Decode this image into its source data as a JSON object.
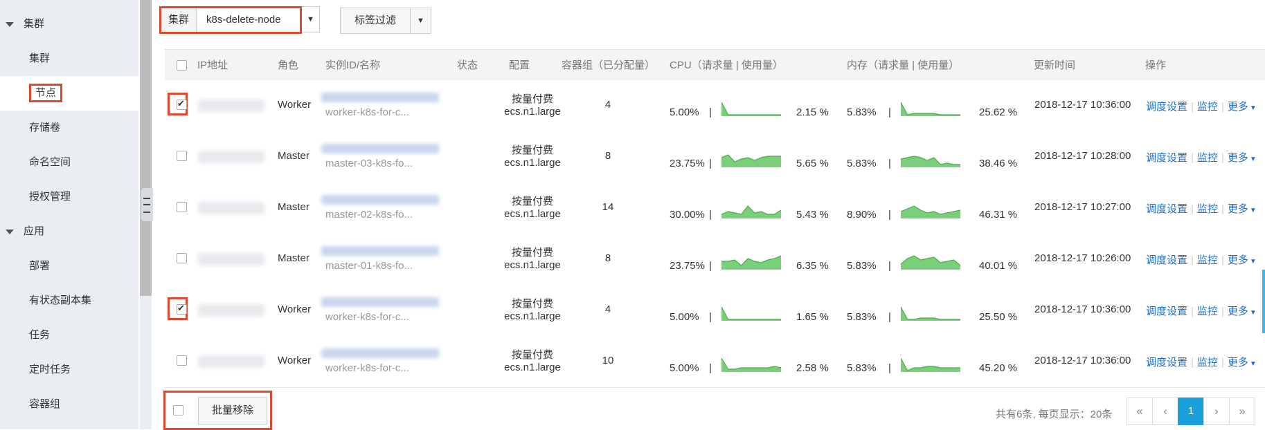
{
  "sidebar": {
    "groups": [
      {
        "label": "集群",
        "items": [
          "集群",
          "节点",
          "存储卷",
          "命名空间",
          "授权管理"
        ]
      },
      {
        "label": "应用",
        "items": [
          "部署",
          "有状态副本集",
          "任务",
          "定时任务",
          "容器组"
        ]
      }
    ],
    "active_item": "节点"
  },
  "filter": {
    "cluster_label": "集群",
    "cluster_value": "k8s-delete-node",
    "tag_filter_label": "标签过滤"
  },
  "table": {
    "headers": [
      "IP地址",
      "角色",
      "实例ID/名称",
      "状态",
      "配置",
      "容器组（已分配量）",
      "CPU（请求量 | 使用量）",
      "内存（请求量 | 使用量）",
      "更新时间",
      "操作"
    ],
    "rows": [
      {
        "checked": true,
        "role": "Worker",
        "name": "worker-k8s-for-c...",
        "billing": "按量付费",
        "spec": "ecs.n1.large",
        "pods": "4",
        "cpu_req": "5.00%",
        "cpu_use": "2.15 %",
        "mem_req": "5.83%",
        "mem_use": "25.62 %",
        "time": "2018-12-17 10:36:00"
      },
      {
        "checked": false,
        "role": "Master",
        "name": "master-03-k8s-fo...",
        "billing": "按量付费",
        "spec": "ecs.n1.large",
        "pods": "8",
        "cpu_req": "23.75%",
        "cpu_use": "5.65 %",
        "mem_req": "5.83%",
        "mem_use": "38.46 %",
        "time": "2018-12-17 10:28:00"
      },
      {
        "checked": false,
        "role": "Master",
        "name": "master-02-k8s-fo...",
        "billing": "按量付费",
        "spec": "ecs.n1.large",
        "pods": "14",
        "cpu_req": "30.00%",
        "cpu_use": "5.43 %",
        "mem_req": "8.90%",
        "mem_use": "46.31 %",
        "time": "2018-12-17 10:27:00"
      },
      {
        "checked": false,
        "role": "Master",
        "name": "master-01-k8s-fo...",
        "billing": "按量付费",
        "spec": "ecs.n1.large",
        "pods": "8",
        "cpu_req": "23.75%",
        "cpu_use": "6.35 %",
        "mem_req": "5.83%",
        "mem_use": "40.01 %",
        "time": "2018-12-17 10:26:00"
      },
      {
        "checked": true,
        "role": "Worker",
        "name": "worker-k8s-for-c...",
        "billing": "按量付费",
        "spec": "ecs.n1.large",
        "pods": "4",
        "cpu_req": "5.00%",
        "cpu_use": "1.65 %",
        "mem_req": "5.83%",
        "mem_use": "25.50 %",
        "time": "2018-12-17 10:36:00"
      },
      {
        "checked": false,
        "role": "Worker",
        "name": "worker-k8s-for-c...",
        "billing": "按量付费",
        "spec": "ecs.n1.large",
        "pods": "10",
        "cpu_req": "5.00%",
        "cpu_use": "2.58 %",
        "mem_req": "5.83%",
        "mem_use": "45.20 %",
        "time": "2018-12-17 10:36:00"
      }
    ],
    "ops": {
      "schedule": "调度设置",
      "monitor": "监控",
      "more": "更多"
    },
    "sep": "|"
  },
  "footer": {
    "bulk_remove": "批量移除",
    "page_info": "共有6条, 每页显示：20条",
    "pager": [
      "«",
      "‹",
      "1",
      "›",
      "»"
    ]
  },
  "colors": {
    "accent": "#1a6ec8",
    "highlight": "#e0472e",
    "sparkline": "#7ccf7a",
    "pager_active": "#1a9fd8"
  }
}
